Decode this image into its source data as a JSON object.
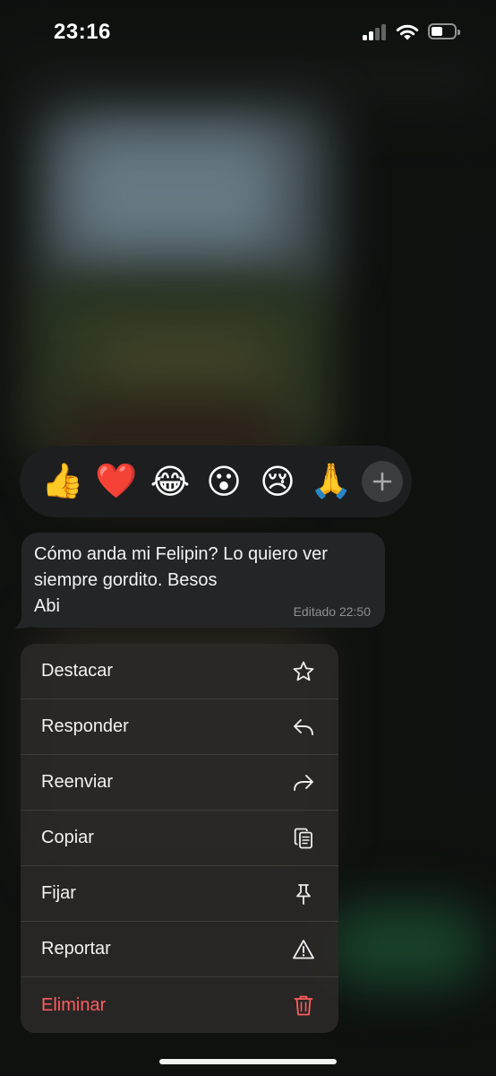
{
  "status_bar": {
    "time": "23:16",
    "signal_icon": "cellular-signal-icon",
    "wifi_icon": "wifi-icon",
    "battery_icon": "battery-icon",
    "battery_level": 0.55
  },
  "reactions": [
    {
      "emoji": "👍",
      "name": "thumbs-up-reaction"
    },
    {
      "emoji": "❤️",
      "name": "red-heart-reaction"
    },
    {
      "emoji": "😂",
      "name": "tears-of-joy-reaction"
    },
    {
      "emoji": "😮",
      "name": "surprised-reaction"
    },
    {
      "emoji": "😢",
      "name": "crying-reaction"
    },
    {
      "emoji": "🙏",
      "name": "folded-hands-reaction"
    }
  ],
  "message": {
    "text": "Cómo anda mi Felipin? Lo quiero ver\nsiempre gordito. Besos\nAbi",
    "meta": "Editado 22:50"
  },
  "menu": {
    "items": [
      {
        "label": "Destacar",
        "icon": "star-icon"
      },
      {
        "label": "Responder",
        "icon": "reply-icon"
      },
      {
        "label": "Reenviar",
        "icon": "forward-icon"
      },
      {
        "label": "Copiar",
        "icon": "copy-icon"
      },
      {
        "label": "Fijar",
        "icon": "pin-icon"
      },
      {
        "label": "Reportar",
        "icon": "warning-icon"
      },
      {
        "label": "Eliminar",
        "icon": "trash-icon"
      }
    ]
  },
  "colors": {
    "menu_background": "#2a2826",
    "bubble_background": "#232526",
    "danger": "#ff5c5f"
  }
}
